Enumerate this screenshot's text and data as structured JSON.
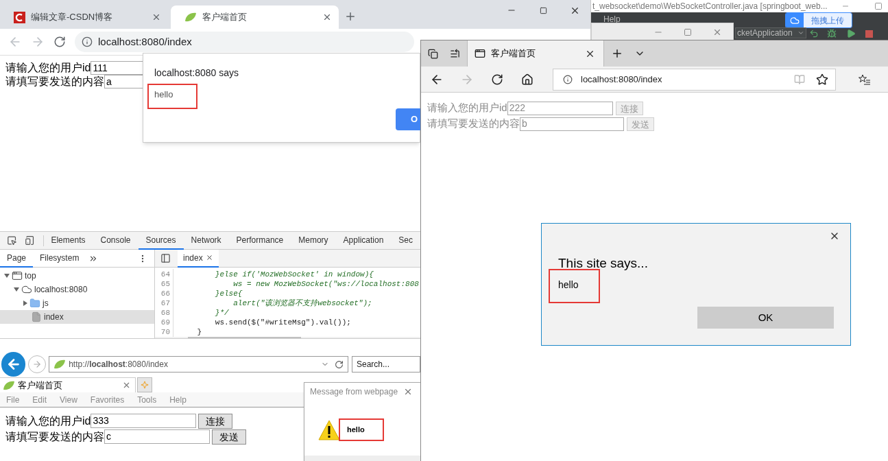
{
  "chrome": {
    "tabs": [
      {
        "title": "编辑文章-CSDN博客",
        "selected": false
      },
      {
        "title": "客户端首页",
        "selected": true
      }
    ],
    "can_go_back": false,
    "can_go_forward": false,
    "url": "localhost:8080/index",
    "form": {
      "dimmed": false,
      "rows": [
        {
          "label": "请输入您的用户id",
          "value": "111"
        },
        {
          "label": "请填写要发送的内容",
          "value": "a"
        }
      ]
    },
    "alert": {
      "title": "localhost:8080 says",
      "message": "hello",
      "highlighted": true,
      "button": "O"
    }
  },
  "devtools": {
    "tabs": [
      {
        "label": "Elements",
        "selected": false
      },
      {
        "label": "Console",
        "selected": false
      },
      {
        "label": "Sources",
        "selected": true
      },
      {
        "label": "Network",
        "selected": false
      },
      {
        "label": "Performance",
        "selected": false
      },
      {
        "label": "Memory",
        "selected": false
      },
      {
        "label": "Application",
        "selected": false
      },
      {
        "label": "Sec",
        "selected": false
      }
    ],
    "navigator_tabs": [
      {
        "label": "Page",
        "selected": true
      },
      {
        "label": "Filesystem",
        "selected": false
      }
    ],
    "tree": [
      {
        "label": "top",
        "kind": "frame",
        "expanded": true,
        "selected": false,
        "children": [
          {
            "label": "localhost:8080",
            "kind": "origin",
            "expanded": true,
            "selected": false,
            "children": [
              {
                "label": "js",
                "kind": "folder",
                "expanded": false,
                "selected": false
              },
              {
                "label": "index",
                "kind": "file",
                "selected": true
              }
            ]
          }
        ]
      }
    ],
    "editor_tabs": [
      {
        "label": "index",
        "selected": true
      }
    ],
    "code": [
      {
        "number": "64",
        "text": "        }else if('MozWebSocket' in window){",
        "kind": "comment"
      },
      {
        "number": "65",
        "text": "            ws = new MozWebSocket(\"ws://localhost:808",
        "kind": "comment"
      },
      {
        "number": "66",
        "text": "        }else{",
        "kind": "comment"
      },
      {
        "number": "67",
        "text": "            alert(\"该浏览器不支持websocket\");",
        "kind": "comment"
      },
      {
        "number": "68",
        "text": "        }*/",
        "kind": "comment"
      },
      {
        "number": "69",
        "text": "        ws.send($(\"#writeMsg\").val());",
        "kind": "code"
      },
      {
        "number": "70",
        "text": "    }",
        "kind": "code"
      }
    ]
  },
  "ide": {
    "title": "t_websocket\\demo\\WebSocketController.java [springboot_web...",
    "menu": [
      "Help"
    ],
    "upload_button": "拖拽上传",
    "run_config": "cketApplication"
  },
  "edge": {
    "tabs": [
      {
        "title": "客户端首页",
        "selected": true
      }
    ],
    "can_go_forward": false,
    "url": "localhost:8080/index",
    "form": {
      "dimmed": true,
      "rows": [
        {
          "label": "请输入您的用户id",
          "value": "222",
          "button": "连接"
        },
        {
          "label": "请填写要发送的内容",
          "value": "b",
          "button": "发送"
        }
      ]
    },
    "dialog": {
      "title": "This site says...",
      "message": "hello",
      "highlighted": true,
      "button": "OK"
    }
  },
  "ie": {
    "can_go_forward": false,
    "url": "http://**localhost**:8080/index",
    "search": {
      "placeholder": "Search..."
    },
    "tabs": [
      {
        "title": "客户端首页",
        "selected": true
      }
    ],
    "menu": [
      "File",
      "Edit",
      "View",
      "Favorites",
      "Tools",
      "Help"
    ],
    "form": {
      "dimmed": false,
      "rows": [
        {
          "label": "请输入您的用户id",
          "value": "333",
          "button": "连接"
        },
        {
          "label": "请填写要发送的内容",
          "value": "c",
          "button": "发送"
        }
      ]
    },
    "dialog": {
      "title": "Message from webpage",
      "message": "hello",
      "highlighted": true
    }
  }
}
